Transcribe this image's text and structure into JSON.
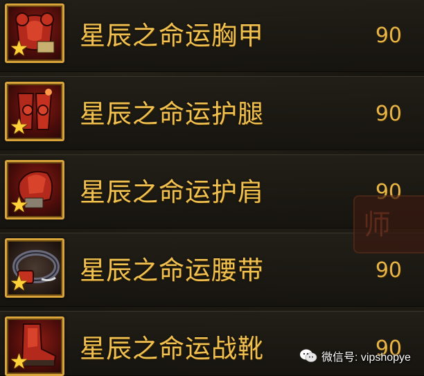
{
  "items": [
    {
      "name": "星辰之命运胸甲",
      "level": "90",
      "icon": "chest-armor-icon"
    },
    {
      "name": "星辰之命运护腿",
      "level": "90",
      "icon": "leg-armor-icon"
    },
    {
      "name": "星辰之命运护肩",
      "level": "90",
      "icon": "shoulder-armor-icon"
    },
    {
      "name": "星辰之命运腰带",
      "level": "90",
      "icon": "belt-icon"
    },
    {
      "name": "星辰之命运战靴",
      "level": "90",
      "icon": "boots-icon"
    }
  ],
  "star_icon": "star-icon",
  "background_badge": "师",
  "watermark": {
    "text": "微信号: vipshopye",
    "icon": "wechat-icon"
  },
  "colors": {
    "item_name": "#f0c050",
    "level": "#e6b447",
    "frame_gold": "#d9a43a",
    "icon_red": "#8a1c14",
    "star": "#ffd23a"
  }
}
